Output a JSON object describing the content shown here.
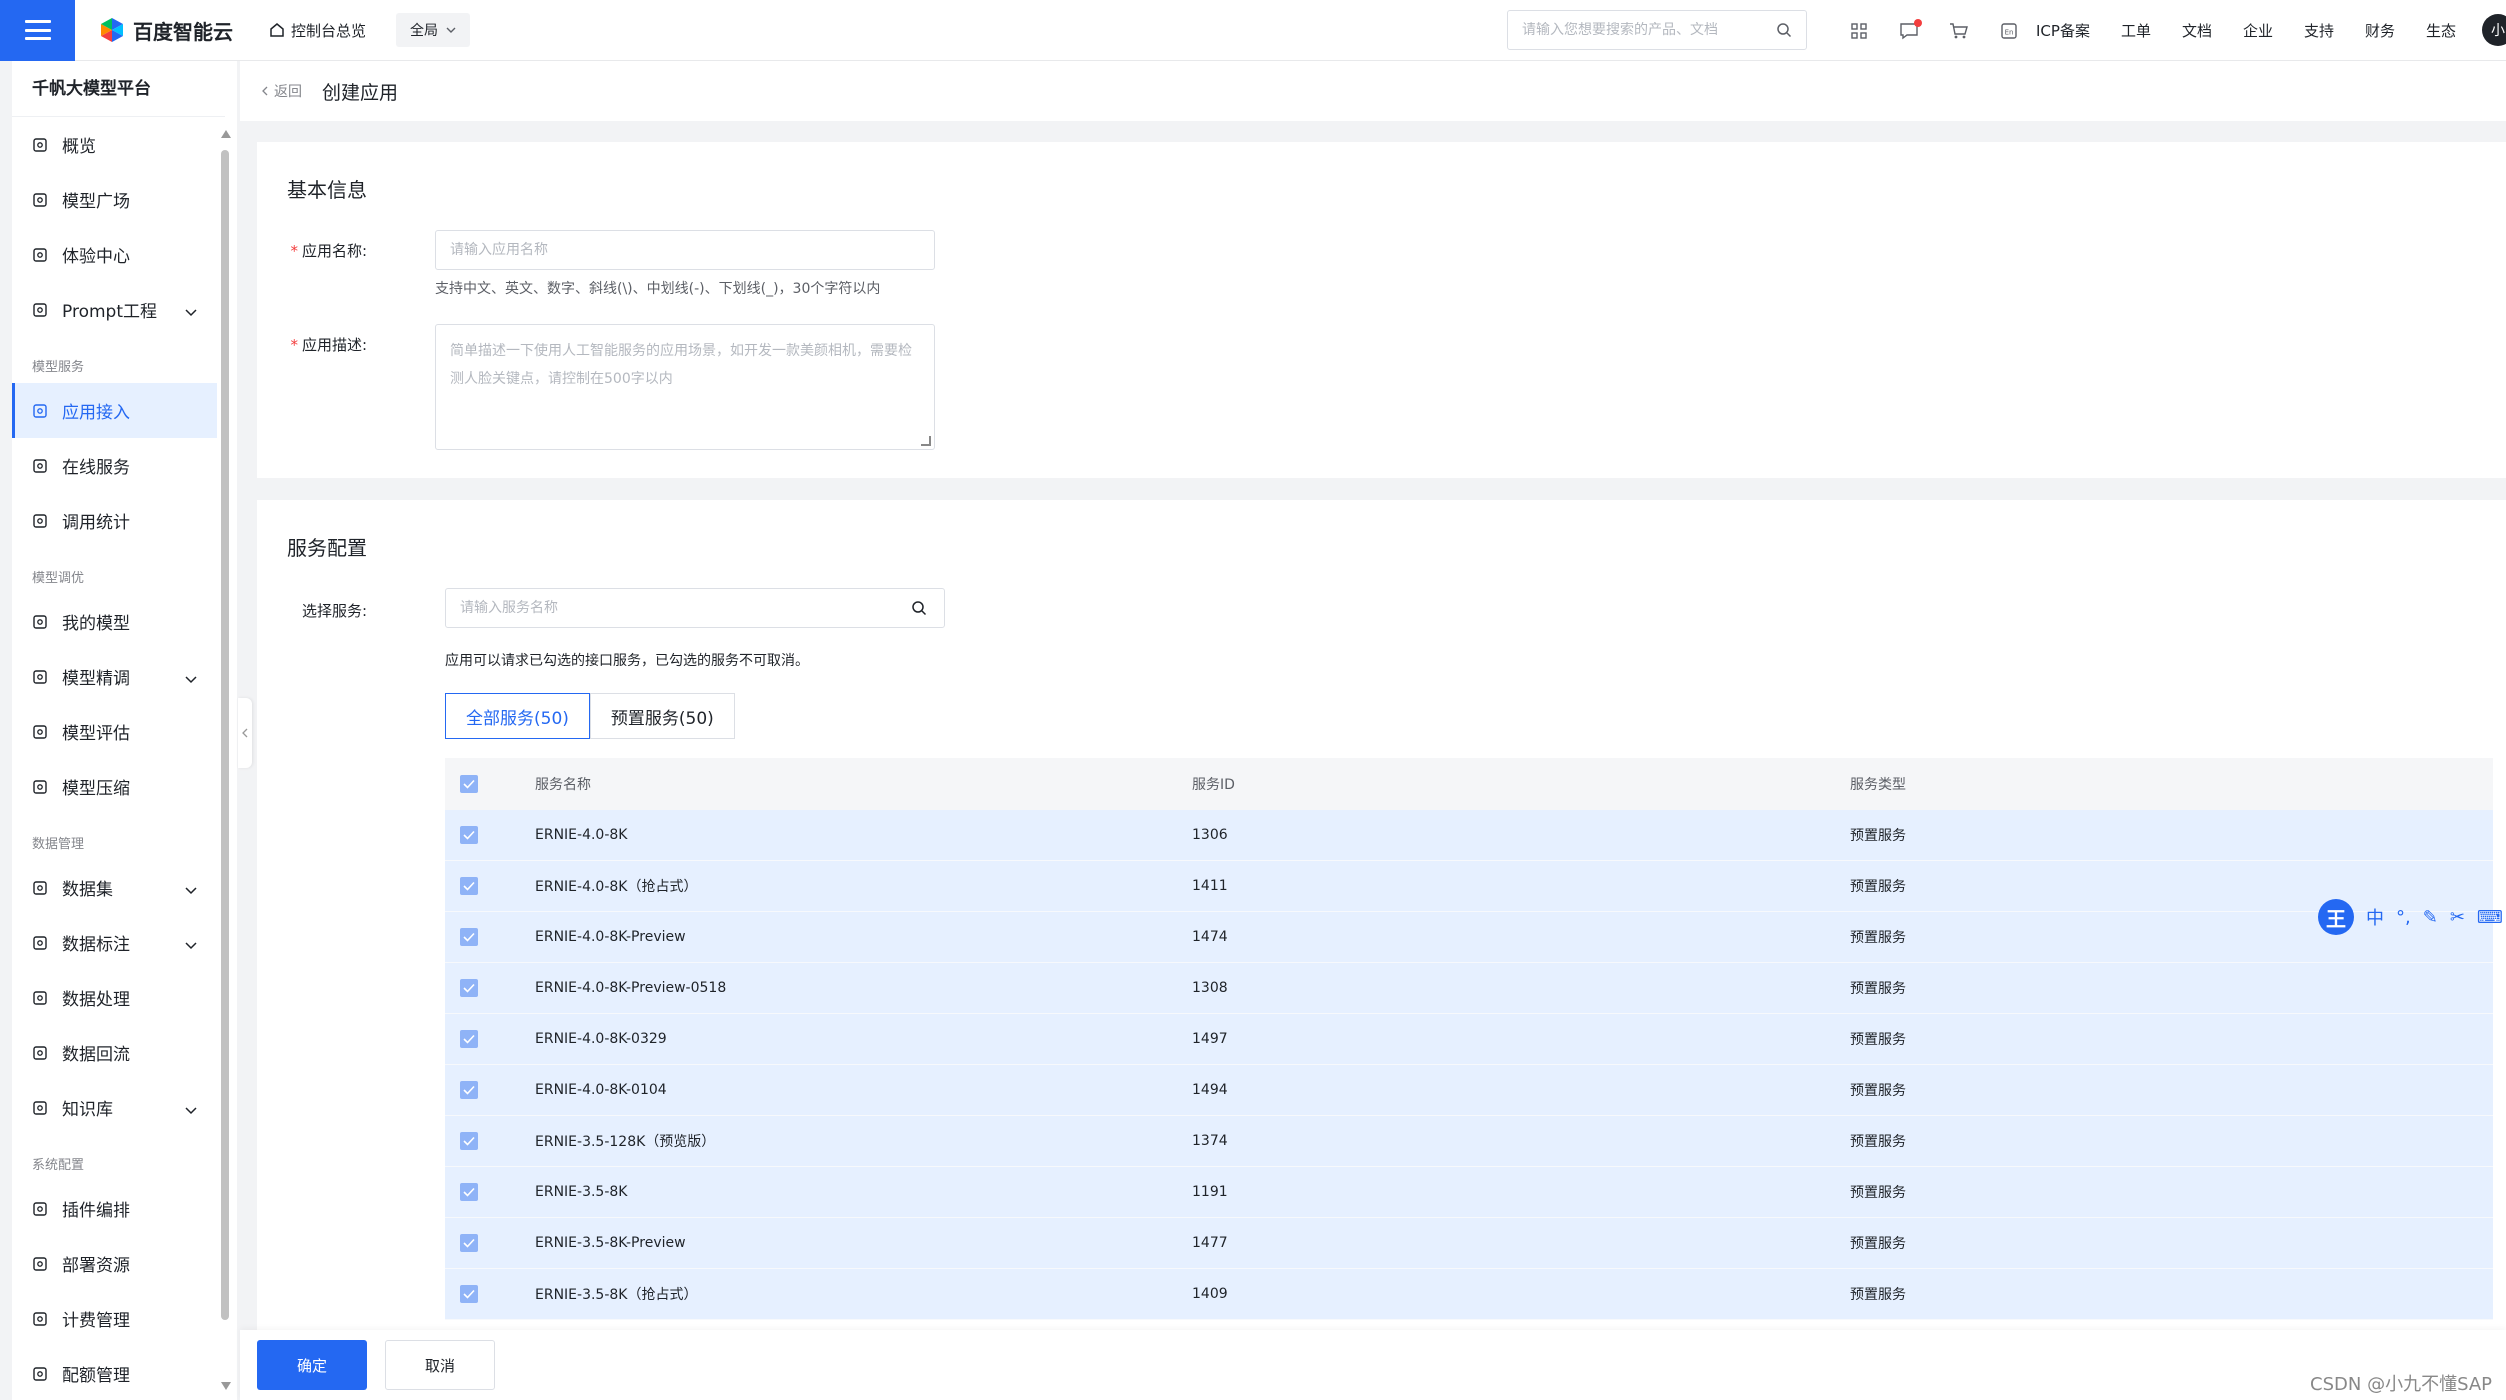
{
  "topbar": {
    "brand": "百度智能云",
    "home": "控制台总览",
    "region": "全局",
    "search_placeholder": "请输入您想要搜索的产品、文档",
    "links": [
      "ICP备案",
      "工单",
      "文档",
      "企业",
      "支持",
      "财务",
      "生态"
    ],
    "avatar": "小"
  },
  "sidebar": {
    "title": "千帆大模型平台",
    "sections": [
      {
        "group": "",
        "items": [
          {
            "label": "概览",
            "icon": "grid-icon"
          },
          {
            "label": "模型广场",
            "icon": "model-square-icon"
          },
          {
            "label": "体验中心",
            "icon": "experience-icon"
          },
          {
            "label": "Prompt工程",
            "icon": "prompt-icon",
            "expandable": true
          }
        ]
      },
      {
        "group": "模型服务",
        "items": [
          {
            "label": "应用接入",
            "icon": "app-access-icon",
            "active": true
          },
          {
            "label": "在线服务",
            "icon": "online-service-icon"
          },
          {
            "label": "调用统计",
            "icon": "stats-icon"
          }
        ]
      },
      {
        "group": "模型调优",
        "items": [
          {
            "label": "我的模型",
            "icon": "my-model-icon"
          },
          {
            "label": "模型精调",
            "icon": "fine-tune-icon",
            "expandable": true
          },
          {
            "label": "模型评估",
            "icon": "evaluate-icon"
          },
          {
            "label": "模型压缩",
            "icon": "compress-icon"
          }
        ]
      },
      {
        "group": "数据管理",
        "items": [
          {
            "label": "数据集",
            "icon": "dataset-icon",
            "expandable": true
          },
          {
            "label": "数据标注",
            "icon": "annotate-icon",
            "expandable": true
          },
          {
            "label": "数据处理",
            "icon": "process-icon"
          },
          {
            "label": "数据回流",
            "icon": "reflow-icon"
          },
          {
            "label": "知识库",
            "icon": "knowledge-icon",
            "expandable": true
          }
        ]
      },
      {
        "group": "系统配置",
        "items": [
          {
            "label": "插件编排",
            "icon": "plugin-icon"
          },
          {
            "label": "部署资源",
            "icon": "deploy-icon"
          },
          {
            "label": "计费管理",
            "icon": "billing-icon"
          },
          {
            "label": "配额管理",
            "icon": "quota-icon"
          }
        ]
      }
    ]
  },
  "header": {
    "back": "返回",
    "title": "创建应用"
  },
  "basic": {
    "title": "基本信息",
    "name_label": "应用名称:",
    "name_placeholder": "请输入应用名称",
    "name_hint": "支持中文、英文、数字、斜线(\\)、中划线(-)、下划线(_)，30个字符以内",
    "desc_label": "应用描述:",
    "desc_placeholder": "简单描述一下使用人工智能服务的应用场景，如开发一款美颜相机，需要检测人脸关键点，请控制在500字以内"
  },
  "service": {
    "title": "服务配置",
    "select_label": "选择服务:",
    "search_placeholder": "请输入服务名称",
    "notice": "应用可以请求已勾选的接口服务，已勾选的服务不可取消。",
    "tabs": [
      "全部服务(50)",
      "预置服务(50)"
    ],
    "columns": [
      "服务名称",
      "服务ID",
      "服务类型"
    ],
    "rows": [
      {
        "name": "ERNIE-4.0-8K",
        "id": "1306",
        "type": "预置服务"
      },
      {
        "name": "ERNIE-4.0-8K（抢占式）",
        "id": "1411",
        "type": "预置服务"
      },
      {
        "name": "ERNIE-4.0-8K-Preview",
        "id": "1474",
        "type": "预置服务"
      },
      {
        "name": "ERNIE-4.0-8K-Preview-0518",
        "id": "1308",
        "type": "预置服务"
      },
      {
        "name": "ERNIE-4.0-8K-0329",
        "id": "1497",
        "type": "预置服务"
      },
      {
        "name": "ERNIE-4.0-8K-0104",
        "id": "1494",
        "type": "预置服务"
      },
      {
        "name": "ERNIE-3.5-128K（预览版）",
        "id": "1374",
        "type": "预置服务"
      },
      {
        "name": "ERNIE-3.5-8K",
        "id": "1191",
        "type": "预置服务"
      },
      {
        "name": "ERNIE-3.5-8K-Preview",
        "id": "1477",
        "type": "预置服务"
      },
      {
        "name": "ERNIE-3.5-8K（抢占式）",
        "id": "1409",
        "type": "预置服务"
      }
    ]
  },
  "footer": {
    "confirm": "确定",
    "cancel": "取消"
  },
  "watermark": "CSDN @小九不懂SAP",
  "ime": {
    "logo": "王",
    "items": [
      "中",
      "°,",
      "✎",
      "✂",
      "⌨"
    ]
  },
  "colors": {
    "accent": "#2468f2",
    "selected_row": "#e6f0ff",
    "required": "#f33e3e"
  }
}
